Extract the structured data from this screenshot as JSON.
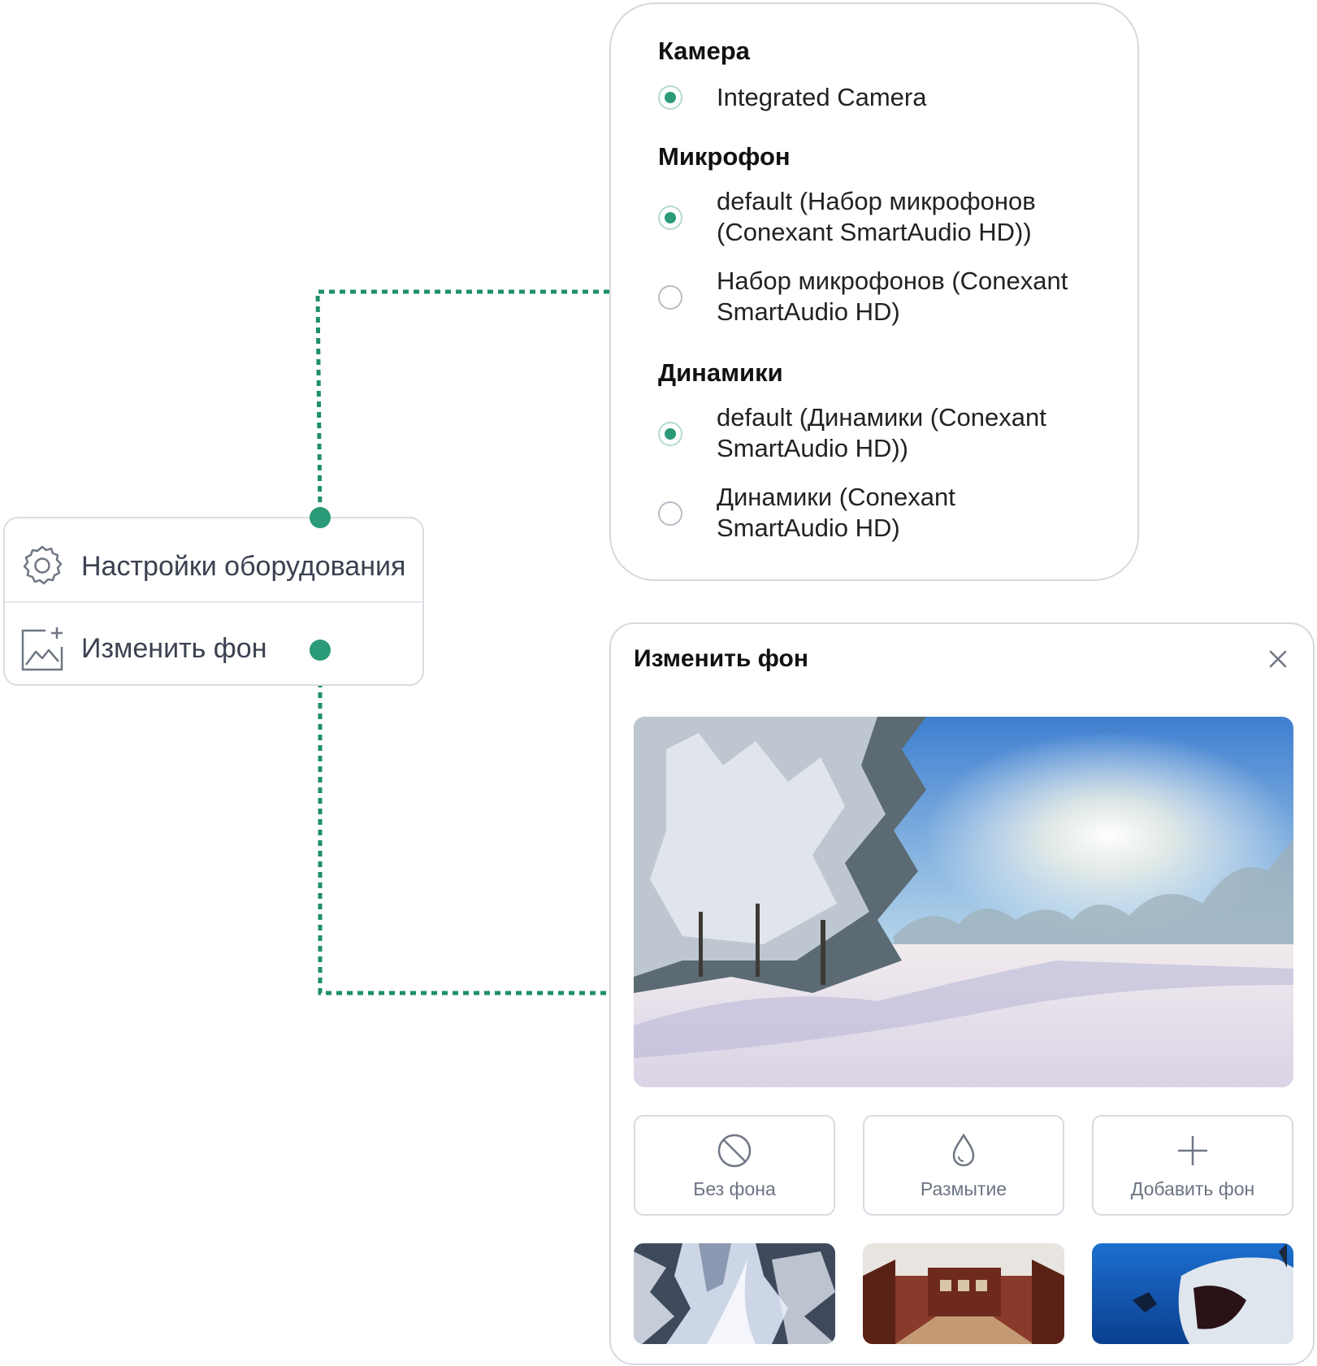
{
  "menu": {
    "hardware_settings": "Настройки оборудования",
    "change_background": "Изменить фон"
  },
  "hardware": {
    "camera_title": "Камера",
    "cameras": [
      {
        "label": "Integrated Camera",
        "checked": true
      }
    ],
    "microphone_title": "Микрофон",
    "microphones": [
      {
        "line1": "default (Набор микрофонов",
        "line2": "(Conexant SmartAudio HD))",
        "checked": true
      },
      {
        "line1": "Набор микрофонов (Conexant",
        "line2": "SmartAudio HD)",
        "checked": false
      }
    ],
    "speakers_title": "Динамики",
    "speakers": [
      {
        "line1": "default (Динамики (Conexant",
        "line2": "SmartAudio HD))",
        "checked": true
      },
      {
        "line1": "Динамики (Conexant",
        "line2": "SmartAudio HD)",
        "checked": false
      }
    ]
  },
  "background_dialog": {
    "title": "Изменить фон",
    "options": {
      "no_background": "Без фона",
      "blur": "Размытие",
      "add_background": "Добавить фон"
    }
  },
  "colors": {
    "accent": "#2a9a78",
    "connector": "#1f8f6a",
    "border": "#d7d9de"
  }
}
